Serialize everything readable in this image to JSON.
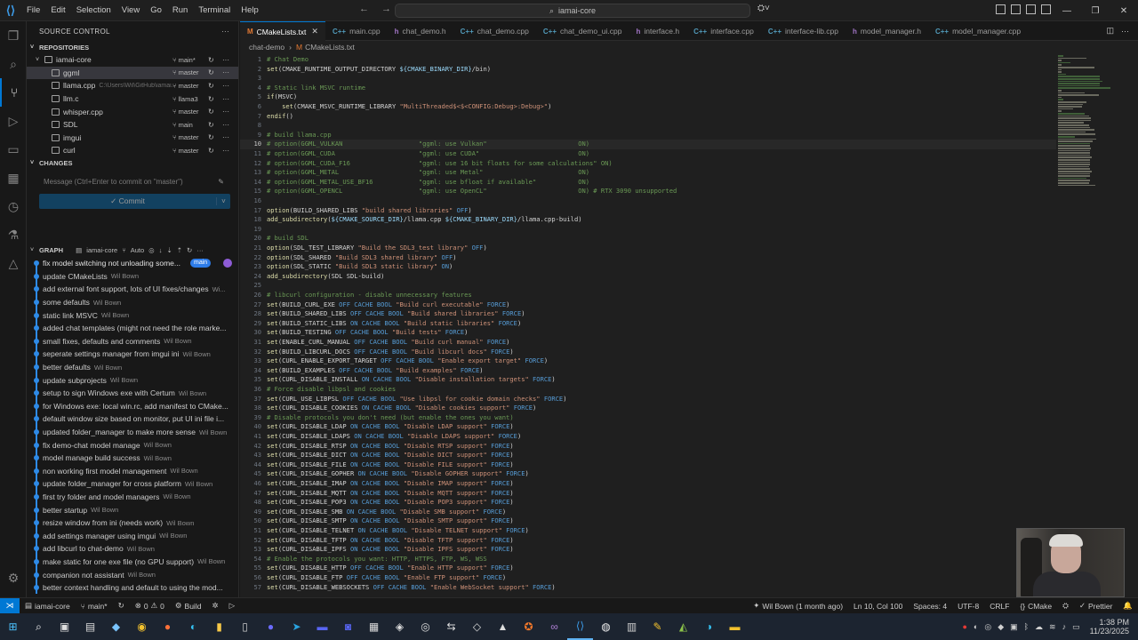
{
  "titlebar": {
    "menu": [
      "File",
      "Edit",
      "Selection",
      "View",
      "Go",
      "Run",
      "Terminal",
      "Help"
    ],
    "search": "iamai-core"
  },
  "sidebar": {
    "title": "SOURCE CONTROL",
    "repositories_label": "REPOSITORIES",
    "repos": [
      {
        "name": "iamai-core",
        "path": "",
        "branch": "main*"
      },
      {
        "name": "ggml",
        "path": "",
        "branch": "master"
      },
      {
        "name": "llama.cpp",
        "path": "C:\\Users\\Wil\\GitHub\\iamai...",
        "branch": "master"
      },
      {
        "name": "llm.c",
        "path": "",
        "branch": "llama3"
      },
      {
        "name": "whisper.cpp",
        "path": "",
        "branch": "master"
      },
      {
        "name": "SDL",
        "path": "",
        "branch": "main"
      },
      {
        "name": "imgui",
        "path": "",
        "branch": "master"
      },
      {
        "name": "curl",
        "path": "",
        "branch": "master"
      }
    ],
    "changes_label": "CHANGES",
    "commit_placeholder": "Message (Ctrl+Enter to commit on \"master\")",
    "commit_button": "Commit",
    "graph_label": "GRAPH",
    "graph_repo": "iamai-core",
    "graph_auto": "Auto",
    "graph_badge": "main",
    "commits": [
      {
        "msg": "fix model switching not unloading some...",
        "author": ""
      },
      {
        "msg": "update CMakeLists",
        "author": "Wil Bown"
      },
      {
        "msg": "add external font support, lots of UI fixes/changes",
        "author": "Wi..."
      },
      {
        "msg": "some defaults",
        "author": "Wil Bown"
      },
      {
        "msg": "static link MSVC",
        "author": "Wil Bown"
      },
      {
        "msg": "added chat templates (might not need the role marke...",
        "author": ""
      },
      {
        "msg": "small fixes, defaults and comments",
        "author": "Wil Bown"
      },
      {
        "msg": "seperate settings manager from imgui ini",
        "author": "Wil Bown"
      },
      {
        "msg": "better defaults",
        "author": "Wil Bown"
      },
      {
        "msg": "update subprojects",
        "author": "Wil Bown"
      },
      {
        "msg": "setup to sign Windows exe with Certum",
        "author": "Wil Bown"
      },
      {
        "msg": "for Windows exe: local win.rc, add manifest to CMake...",
        "author": ""
      },
      {
        "msg": "default window size based on monitor, put UI ini file i...",
        "author": ""
      },
      {
        "msg": "updated folder_manager to make more sense",
        "author": "Wil Bown"
      },
      {
        "msg": "fix demo-chat model manage",
        "author": "Wil Bown"
      },
      {
        "msg": "model manage  build success",
        "author": "Wil Bown"
      },
      {
        "msg": "non working first model management",
        "author": "Wil Bown"
      },
      {
        "msg": "update folder_manager for cross platform",
        "author": "Wil Bown"
      },
      {
        "msg": "first try folder and model managers",
        "author": "Wil Bown"
      },
      {
        "msg": "better startup",
        "author": "Wil Bown"
      },
      {
        "msg": "resize window from ini (needs work)",
        "author": "Wil Bown"
      },
      {
        "msg": "add settings manager using imgui",
        "author": "Wil Bown"
      },
      {
        "msg": "add libcurl to chat-demo",
        "author": "Wil Bown"
      },
      {
        "msg": "make static for one exe file (no GPU support)",
        "author": "Wil Bown"
      },
      {
        "msg": "companion not assistant",
        "author": "Wil Bown"
      },
      {
        "msg": "better context handling and default to using the mod...",
        "author": ""
      }
    ]
  },
  "tabs": [
    {
      "label": "CMakeLists.txt",
      "icon": "M",
      "active": true
    },
    {
      "label": "main.cpp",
      "icon": "C++"
    },
    {
      "label": "chat_demo.h",
      "icon": "h"
    },
    {
      "label": "chat_demo.cpp",
      "icon": "C++"
    },
    {
      "label": "chat_demo_ui.cpp",
      "icon": "C++"
    },
    {
      "label": "interface.h",
      "icon": "h"
    },
    {
      "label": "interface.cpp",
      "icon": "C++"
    },
    {
      "label": "interface-lib.cpp",
      "icon": "C++"
    },
    {
      "label": "model_manager.h",
      "icon": "h"
    },
    {
      "label": "model_manager.cpp",
      "icon": "C++"
    }
  ],
  "breadcrumb": [
    "chat-demo",
    "CMakeLists.txt"
  ],
  "code_lines": [
    {
      "n": "1",
      "t": "# Chat Demo",
      "k": "cm"
    },
    {
      "n": "2",
      "t": "set(CMAKE_RUNTIME_OUTPUT_DIRECTORY ${CMAKE_BINARY_DIR}/bin)",
      "k": "code"
    },
    {
      "n": "3",
      "t": "",
      "k": "code"
    },
    {
      "n": "4",
      "t": "# Static link MSVC runtime",
      "k": "cm"
    },
    {
      "n": "5",
      "t": "if(MSVC)",
      "k": "code"
    },
    {
      "n": "6",
      "t": "    set(CMAKE_MSVC_RUNTIME_LIBRARY \"MultiThreaded$<$<CONFIG:Debug>:Debug>\")",
      "k": "code"
    },
    {
      "n": "7",
      "t": "endif()",
      "k": "code"
    },
    {
      "n": "8",
      "t": "",
      "k": "code"
    },
    {
      "n": "9",
      "t": "# build llama.cpp",
      "k": "cm"
    },
    {
      "n": "10",
      "t": "# option(GGML_VULKAN                    \"ggml: use Vulkan\"                        ON)",
      "k": "cm",
      "hl": true
    },
    {
      "n": "11",
      "t": "# option(GGML_CUDA                      \"ggml: use CUDA\"                          ON)",
      "k": "cm"
    },
    {
      "n": "12",
      "t": "# option(GGML_CUDA_F16                  \"ggml: use 16 bit floats for some calculations\" ON)",
      "k": "cm"
    },
    {
      "n": "13",
      "t": "# option(GGML_METAL                     \"ggml: use Metal\"                         ON)",
      "k": "cm"
    },
    {
      "n": "14",
      "t": "# option(GGML_METAL_USE_BF16            \"ggml: use bfloat if available\"           ON)",
      "k": "cm"
    },
    {
      "n": "15",
      "t": "# option(GGML_OPENCL                    \"ggml: use OpenCL\"                        ON) # RTX 3090 unsupported",
      "k": "cm"
    },
    {
      "n": "16",
      "t": "",
      "k": "code"
    },
    {
      "n": "17",
      "t": "option(BUILD_SHARED_LIBS \"build shared libraries\" OFF)",
      "k": "code"
    },
    {
      "n": "18",
      "t": "add_subdirectory(${CMAKE_SOURCE_DIR}/llama.cpp ${CMAKE_BINARY_DIR}/llama.cpp-build)",
      "k": "code"
    },
    {
      "n": "19",
      "t": "",
      "k": "code"
    },
    {
      "n": "20",
      "t": "# build SDL",
      "k": "cm"
    },
    {
      "n": "21",
      "t": "option(SDL_TEST_LIBRARY \"Build the SDL3_test library\" OFF)",
      "k": "code"
    },
    {
      "n": "22",
      "t": "option(SDL_SHARED \"Build SDL3 shared library\" OFF)",
      "k": "code"
    },
    {
      "n": "23",
      "t": "option(SDL_STATIC \"Build SDL3 static library\" ON)",
      "k": "code"
    },
    {
      "n": "24",
      "t": "add_subdirectory(SDL SDL-build)",
      "k": "code"
    },
    {
      "n": "25",
      "t": "",
      "k": "code"
    },
    {
      "n": "26",
      "t": "# libcurl configuration - disable unnecessary features",
      "k": "cm"
    },
    {
      "n": "27",
      "t": "set(BUILD_CURL_EXE OFF CACHE BOOL \"Build curl executable\" FORCE)",
      "k": "code"
    },
    {
      "n": "28",
      "t": "set(BUILD_SHARED_LIBS OFF CACHE BOOL \"Build shared libraries\" FORCE)",
      "k": "code"
    },
    {
      "n": "29",
      "t": "set(BUILD_STATIC_LIBS ON CACHE BOOL \"Build static libraries\" FORCE)",
      "k": "code"
    },
    {
      "n": "30",
      "t": "set(BUILD_TESTING OFF CACHE BOOL \"Build tests\" FORCE)",
      "k": "code"
    },
    {
      "n": "31",
      "t": "set(ENABLE_CURL_MANUAL OFF CACHE BOOL \"Build curl manual\" FORCE)",
      "k": "code"
    },
    {
      "n": "32",
      "t": "set(BUILD_LIBCURL_DOCS OFF CACHE BOOL \"Build libcurl docs\" FORCE)",
      "k": "code"
    },
    {
      "n": "33",
      "t": "set(CURL_ENABLE_EXPORT_TARGET OFF CACHE BOOL \"Enable export target\" FORCE)",
      "k": "code"
    },
    {
      "n": "34",
      "t": "set(BUILD_EXAMPLES OFF CACHE BOOL \"Build examples\" FORCE)",
      "k": "code"
    },
    {
      "n": "35",
      "t": "set(CURL_DISABLE_INSTALL ON CACHE BOOL \"Disable installation targets\" FORCE)",
      "k": "code"
    },
    {
      "n": "36",
      "t": "# Force disable libpsl and cookies",
      "k": "cm"
    },
    {
      "n": "37",
      "t": "set(CURL_USE_LIBPSL OFF CACHE BOOL \"Use libpsl for cookie domain checks\" FORCE)",
      "k": "code"
    },
    {
      "n": "38",
      "t": "set(CURL_DISABLE_COOKIES ON CACHE BOOL \"Disable cookies support\" FORCE)",
      "k": "code"
    },
    {
      "n": "39",
      "t": "# Disable protocols you don't need (but enable the ones you want)",
      "k": "cm"
    },
    {
      "n": "40",
      "t": "set(CURL_DISABLE_LDAP ON CACHE BOOL \"Disable LDAP support\" FORCE)",
      "k": "code"
    },
    {
      "n": "41",
      "t": "set(CURL_DISABLE_LDAPS ON CACHE BOOL \"Disable LDAPS support\" FORCE)",
      "k": "code"
    },
    {
      "n": "42",
      "t": "set(CURL_DISABLE_RTSP ON CACHE BOOL \"Disable RTSP support\" FORCE)",
      "k": "code"
    },
    {
      "n": "43",
      "t": "set(CURL_DISABLE_DICT ON CACHE BOOL \"Disable DICT support\" FORCE)",
      "k": "code"
    },
    {
      "n": "44",
      "t": "set(CURL_DISABLE_FILE ON CACHE BOOL \"Disable FILE support\" FORCE)",
      "k": "code"
    },
    {
      "n": "45",
      "t": "set(CURL_DISABLE_GOPHER ON CACHE BOOL \"Disable GOPHER support\" FORCE)",
      "k": "code"
    },
    {
      "n": "46",
      "t": "set(CURL_DISABLE_IMAP ON CACHE BOOL \"Disable IMAP support\" FORCE)",
      "k": "code"
    },
    {
      "n": "47",
      "t": "set(CURL_DISABLE_MQTT ON CACHE BOOL \"Disable MQTT support\" FORCE)",
      "k": "code"
    },
    {
      "n": "48",
      "t": "set(CURL_DISABLE_POP3 ON CACHE BOOL \"Disable POP3 support\" FORCE)",
      "k": "code"
    },
    {
      "n": "49",
      "t": "set(CURL_DISABLE_SMB ON CACHE BOOL \"Disable SMB support\" FORCE)",
      "k": "code"
    },
    {
      "n": "50",
      "t": "set(CURL_DISABLE_SMTP ON CACHE BOOL \"Disable SMTP support\" FORCE)",
      "k": "code"
    },
    {
      "n": "51",
      "t": "set(CURL_DISABLE_TELNET ON CACHE BOOL \"Disable TELNET support\" FORCE)",
      "k": "code"
    },
    {
      "n": "52",
      "t": "set(CURL_DISABLE_TFTP ON CACHE BOOL \"Disable TFTP support\" FORCE)",
      "k": "code"
    },
    {
      "n": "53",
      "t": "set(CURL_DISABLE_IPFS ON CACHE BOOL \"Disable IPFS support\" FORCE)",
      "k": "code"
    },
    {
      "n": "54",
      "t": "# Enable the protocols you want: HTTP, HTTPS, FTP, WS, WSS",
      "k": "cm"
    },
    {
      "n": "55",
      "t": "set(CURL_DISABLE_HTTP OFF CACHE BOOL \"Enable HTTP support\" FORCE)",
      "k": "code"
    },
    {
      "n": "56",
      "t": "set(CURL_DISABLE_FTP OFF CACHE BOOL \"Enable FTP support\" FORCE)",
      "k": "code"
    },
    {
      "n": "57",
      "t": "set(CURL_DISABLE_WEBSOCKETS OFF CACHE BOOL \"Enable WebSocket support\" FORCE)",
      "k": "code"
    }
  ],
  "statusbar": {
    "repo": "iamai-core",
    "branch": "main*",
    "problems": "0",
    "warnings": "0",
    "build": "Build",
    "blame": "Wil Bown (1 month ago)",
    "position": "Ln 10, Col 100",
    "spaces": "Spaces: 4",
    "encoding": "UTF-8",
    "eol": "CRLF",
    "language": "CMake",
    "prettier": "Prettier"
  },
  "taskbar": {
    "time": "1:38 PM",
    "date": "11/23/2025"
  },
  "colors": {
    "accent": "#0078d4",
    "graph": "#2e8ae6"
  }
}
